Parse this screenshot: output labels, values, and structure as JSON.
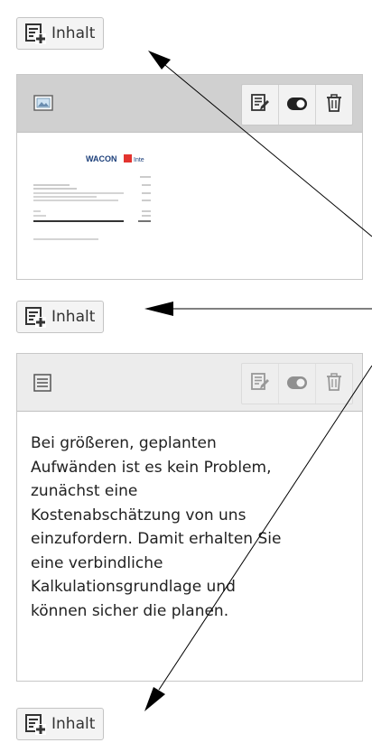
{
  "buttons": {
    "add_content_label": "Inhalt"
  },
  "image_element": {
    "type_icon": "image-icon",
    "toolbar": [
      "edit-icon",
      "toggle-icon",
      "trash-icon"
    ],
    "preview": {
      "logo_text": "WACON",
      "logo_badge": "Inte"
    }
  },
  "text_element": {
    "type_icon": "text-document-icon",
    "toolbar": [
      "edit-icon",
      "toggle-icon",
      "trash-icon"
    ],
    "text": "Bei größeren, geplanten\nAufwänden ist es kein Problem,\nzunächst eine\nKostenabschätzung von uns\neinzufordern. Damit erhalten Sie\neine verbindliche\nKalkulationsgrundlage und\nkönnen sicher die planen."
  },
  "colors": {
    "accent_logo": "#e3342f",
    "header_active": "#d0d0d0",
    "header_inactive": "#ececec"
  }
}
